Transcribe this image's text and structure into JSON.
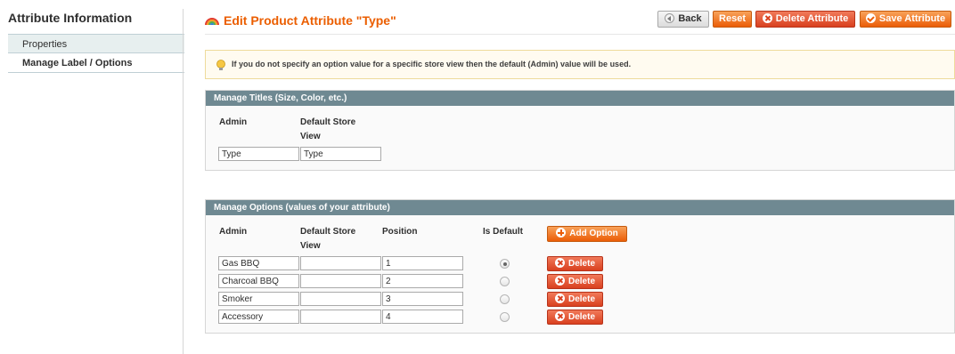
{
  "sidebar": {
    "title": "Attribute Information",
    "items": [
      {
        "label": "Properties",
        "active": false
      },
      {
        "label": "Manage Label / Options",
        "active": true
      }
    ]
  },
  "header": {
    "title": "Edit Product Attribute \"Type\"",
    "icon": "rainbow-icon",
    "buttons": {
      "back": "Back",
      "reset": "Reset",
      "delete": "Delete Attribute",
      "save": "Save Attribute"
    }
  },
  "notice": {
    "icon": "lightbulb-icon",
    "text": "If you do not specify an option value for a specific store view then the default (Admin) value will be used."
  },
  "titles_section": {
    "heading": "Manage Titles (Size, Color, etc.)",
    "columns": {
      "admin": "Admin",
      "store_line1": "Default Store",
      "store_line2": "View"
    },
    "values": {
      "admin": "Type",
      "store": "Type"
    }
  },
  "options_section": {
    "heading": "Manage Options (values of your attribute)",
    "columns": {
      "admin": "Admin",
      "store_line1": "Default Store",
      "store_line2": "View",
      "position": "Position",
      "is_default": "Is Default"
    },
    "add_label": "Add Option",
    "delete_label": "Delete",
    "rows": [
      {
        "admin": "Gas BBQ",
        "store": "",
        "position": "1",
        "is_default": true
      },
      {
        "admin": "Charcoal BBQ",
        "store": "",
        "position": "2",
        "is_default": false
      },
      {
        "admin": "Smoker",
        "store": "",
        "position": "3",
        "is_default": false
      },
      {
        "admin": "Accessory",
        "store": "",
        "position": "4",
        "is_default": false
      }
    ]
  },
  "colors": {
    "accent": "#eb5e00",
    "section_header": "#6f8992",
    "notice_bg": "#fffbf0"
  }
}
